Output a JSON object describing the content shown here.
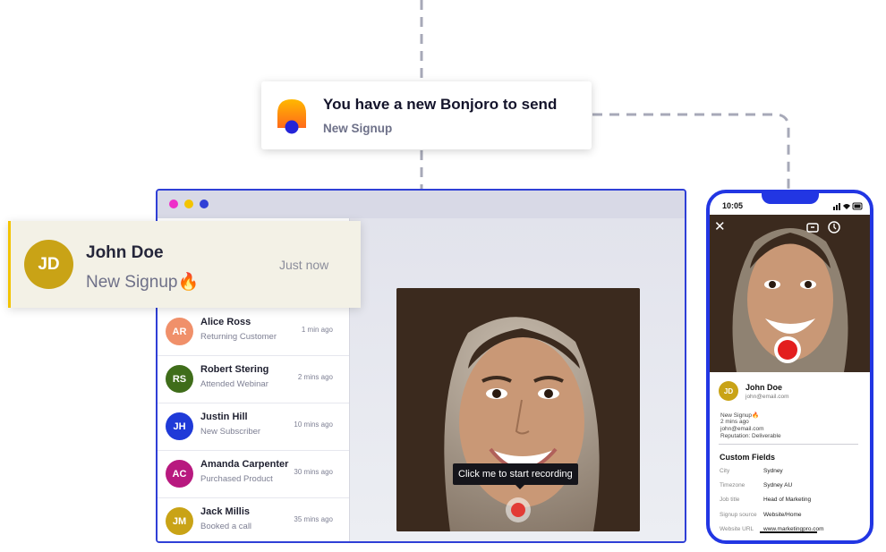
{
  "notification": {
    "title": "You have a new Bonjoro to send",
    "subtitle": "New Signup",
    "logo_icon": "bonjoro-logo-icon"
  },
  "toast": {
    "initials": "JD",
    "name": "John Doe",
    "subtitle": "New Signup🔥",
    "time": "Just now",
    "accent": "#f3c400"
  },
  "browser": {
    "dots": [
      "#ee2fc9",
      "#f3c400",
      "#2f3fd6"
    ],
    "tooltip": "Click me to start recording",
    "contacts": [
      {
        "initials": "AR",
        "name": "Alice Ross",
        "subtitle": "Returning Customer",
        "time": "1 min ago",
        "color": "#f0906a"
      },
      {
        "initials": "RS",
        "name": "Robert Stering",
        "subtitle": "Attended Webinar",
        "time": "2 mins ago",
        "color": "#3f6d1a"
      },
      {
        "initials": "JH",
        "name": "Justin Hill",
        "subtitle": "New Subscriber",
        "time": "10 mins ago",
        "color": "#1f3ad8"
      },
      {
        "initials": "AC",
        "name": "Amanda Carpenter",
        "subtitle": "Purchased Product",
        "time": "30 mins ago",
        "color": "#b8197f"
      },
      {
        "initials": "JM",
        "name": "Jack Millis",
        "subtitle": "Booked a call",
        "time": "35 mins ago",
        "color": "#c9a316"
      }
    ]
  },
  "phone": {
    "status_time": "10:05",
    "contact": {
      "initials": "JD",
      "name": "John Doe",
      "email": "john@email.com"
    },
    "details": [
      "New Signup🔥",
      "2 mins ago",
      "john@email.com",
      "Reputation: Deliverable"
    ],
    "custom_fields_title": "Custom Fields",
    "fields": [
      {
        "label": "City",
        "value": "Sydney"
      },
      {
        "label": "Timezone",
        "value": "Sydney AU"
      },
      {
        "label": "Job title",
        "value": "Head of Marketing"
      },
      {
        "label": "Signup source",
        "value": "Website/Home"
      },
      {
        "label": "Website URL",
        "value": "www.marketingpro.com"
      }
    ]
  }
}
